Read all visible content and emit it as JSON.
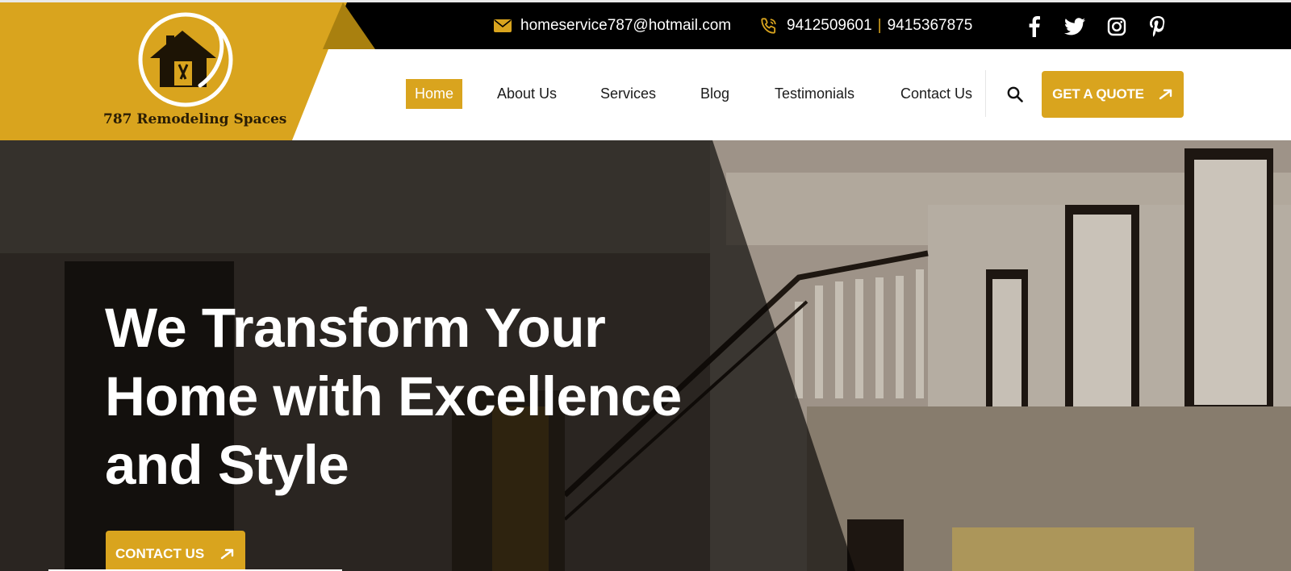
{
  "topbar": {
    "email": "homeservice787@hotmail.com",
    "phone_primary": "9412509601",
    "phone_separator": "|",
    "phone_secondary": "9415367875",
    "social_icons": [
      "facebook-icon",
      "twitter-icon",
      "instagram-icon",
      "pinterest-icon"
    ]
  },
  "brand": {
    "name": "787 Remodeling Spaces"
  },
  "nav": {
    "items": [
      {
        "label": "Home",
        "active": true
      },
      {
        "label": "About Us",
        "active": false
      },
      {
        "label": "Services",
        "active": false
      },
      {
        "label": "Blog",
        "active": false
      },
      {
        "label": "Testimonials",
        "active": false
      },
      {
        "label": "Contact Us",
        "active": false
      }
    ],
    "search_icon": "search-icon",
    "cta_label": "GET A QUOTE"
  },
  "hero": {
    "title_line1": "We Transform Your",
    "title_line2": "Home with Excellence",
    "title_line3": "and Style",
    "cta_label": "CONTACT US"
  },
  "colors": {
    "accent": "#d9a41e",
    "topbar_bg": "#000000",
    "nav_bg": "#ffffff",
    "hero_text": "#ffffff"
  }
}
